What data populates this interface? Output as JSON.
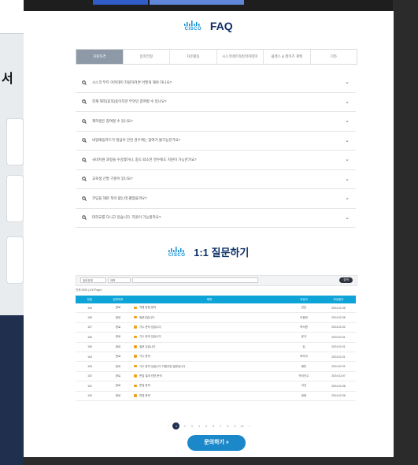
{
  "brand": {
    "logo_text": "CISCO",
    "faq_title": "FAQ",
    "ask_title": "1:1 질문하기"
  },
  "tabs": [
    "지원자격",
    "입학전형",
    "자유활동",
    "시스코네트워킹아카데미",
    "클래스 & 레이즈 계획",
    "기타"
  ],
  "faq": [
    "시스코 부트 아카데미 지원하려면 어떻게 해야 하나요?",
    "현재 재직(휴직)중이지만 무엇인 참여할 수 있나요?",
    "재학생은 참여할 수 있나요?",
    "내일배움카드가 발급이 안된 경우에는 참여가 불가능한가요?",
    "국비지원 과정을 수강했거나, 중도 퇴소한 경우에도 지원이 가능한가요?",
    "교육생 선발 기준이 있나요?",
    "코딩을 해본 적이 없는데 괜찮을까요?",
    "대학교를 다니고 있습니다. 지원이 가능할까요?"
  ],
  "search": {
    "select1": "질문유형",
    "select2": "제목",
    "button": "검색"
  },
  "table": {
    "total": "전체 3000 (1/37Page)",
    "headers": [
      "번호",
      "답변여부",
      "제목",
      "작성자",
      "작성일자"
    ],
    "rows": [
      [
        "109",
        "완료",
        "지원 방법 문의",
        "권은",
        "2024.02.05"
      ],
      [
        "108",
        "완료",
        "질문있습니다",
        "이종현",
        "2024.02.05"
      ],
      [
        "107",
        "완료",
        "기수 문의 있습니다",
        "박서원",
        "2024.02.02"
      ],
      [
        "106",
        "완료",
        "기수 문의 있습니다",
        "윤석",
        "2024.02.01"
      ],
      [
        "105",
        "완료",
        "질문 있습니다",
        "김",
        "2024.02.01"
      ],
      [
        "104",
        "완료",
        "기수 문의",
        "하리아",
        "2024.02.01"
      ],
      [
        "103",
        "완료",
        "기수 문의 있습니다 지원관련 질문입니다",
        "배민",
        "2024.02.01"
      ],
      [
        "102",
        "완료",
        "면접 결과 관련 문의",
        "박석진수",
        "2024.02.07"
      ],
      [
        "101",
        "완료",
        "면접 문의",
        "이진",
        "2024.02.06"
      ],
      [
        "100",
        "완료",
        "면접 문의",
        "정현",
        "2024.02.06"
      ]
    ]
  },
  "pager": {
    "prev": "‹",
    "pages": [
      "1",
      "2",
      "3",
      "4",
      "5",
      "6",
      "7",
      "8",
      "9",
      "10"
    ],
    "next": "›"
  },
  "ask_button": "문의하기",
  "colors": {
    "accent": "#0ea4d8",
    "navy": "#0d2f66",
    "button": "#1b88c9"
  }
}
